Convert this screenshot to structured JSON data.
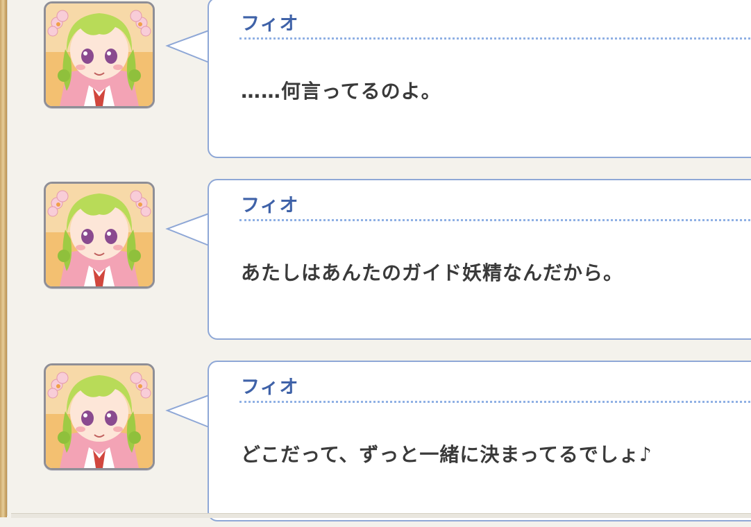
{
  "messages": [
    {
      "speaker": "フィオ",
      "text": "……何言ってるのよ。",
      "avatar_icon": "fio-portrait-icon"
    },
    {
      "speaker": "フィオ",
      "text": "あたしはあんたのガイド妖精なんだから。",
      "avatar_icon": "fio-portrait-icon"
    },
    {
      "speaker": "フィオ",
      "text": "どこだって、ずっと一緒に決まってるでしょ♪",
      "avatar_icon": "fio-portrait-icon"
    }
  ],
  "colors": {
    "speaker_name": "#3f62a8",
    "bubble_border": "#8ea7d6",
    "frame_gold": "#c9a567",
    "background": "#f3f1ec"
  }
}
